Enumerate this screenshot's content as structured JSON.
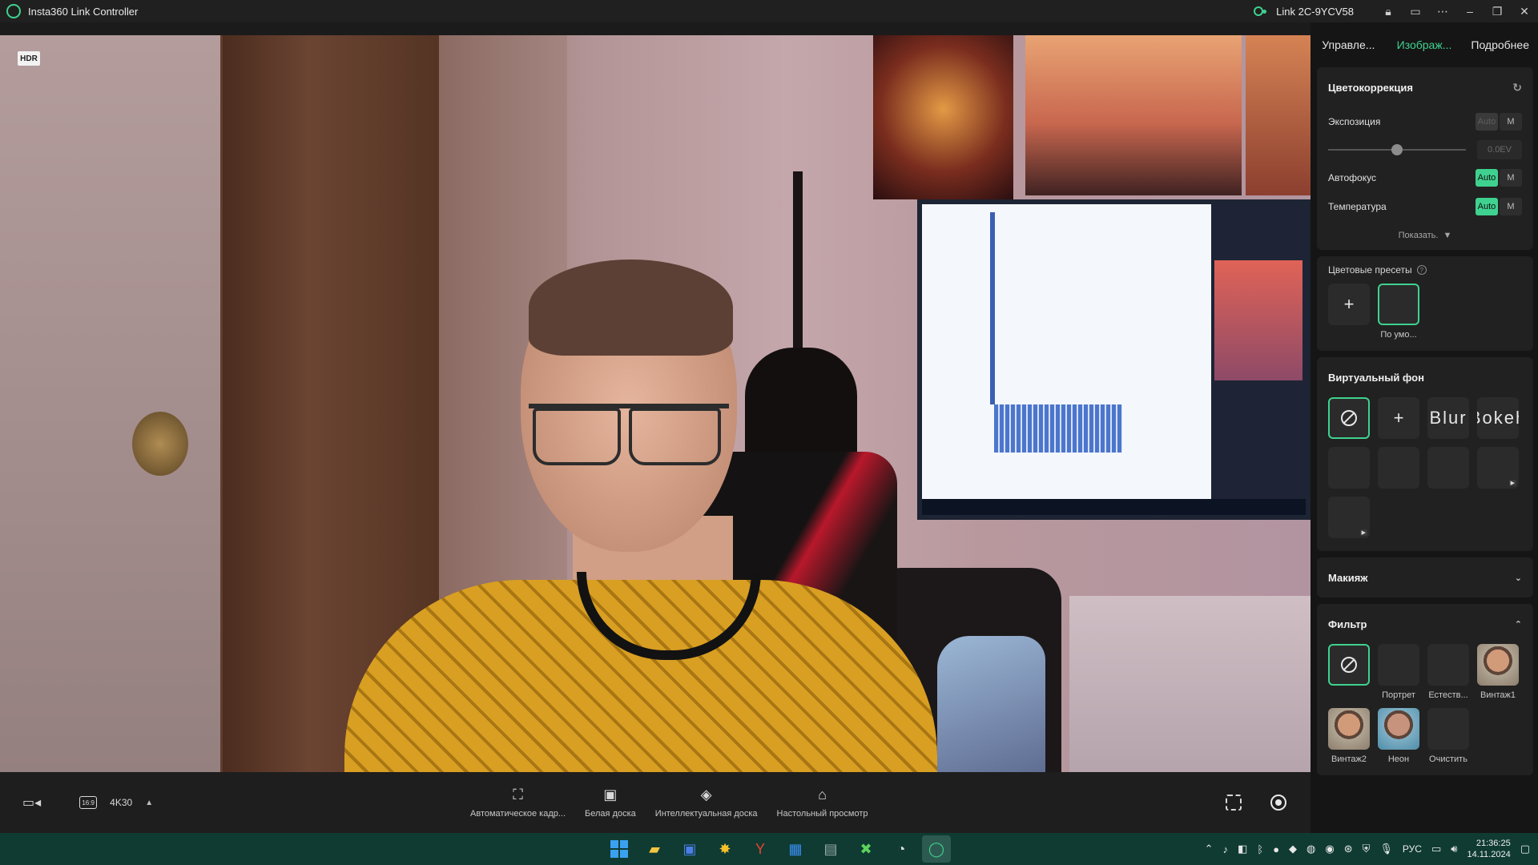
{
  "window": {
    "title": "Insta360 Link Controller",
    "device": "Link 2C-9YCV58"
  },
  "video": {
    "hdr_badge": "HDR"
  },
  "bottombar": {
    "ratio_label": "16:9",
    "resolution": "4K30",
    "tools": [
      {
        "label": "Автоматическое кадр..."
      },
      {
        "label": "Белая доска"
      },
      {
        "label": "Интеллектуальная доска"
      },
      {
        "label": "Настольный просмотр"
      }
    ]
  },
  "panel": {
    "tabs": [
      "Управле...",
      "Изображ...",
      "Подробнее"
    ],
    "active_tab": 1,
    "color_correction": {
      "title": "Цветокоррекция",
      "exposure_label": "Экспозиция",
      "exposure_value": "0.0EV",
      "exposure_slider": 0.5,
      "autofocus_label": "Автофокус",
      "temperature_label": "Температура",
      "auto": "Auto",
      "manual": "M",
      "show_more": "Показать."
    },
    "color_presets": {
      "title": "Цветовые пресеты",
      "default_caption": "По умо..."
    },
    "virtual_bg": {
      "title": "Виртуальный фон",
      "blur": "Blur",
      "bokeh": "Bokeh"
    },
    "makeup": {
      "title": "Макияж"
    },
    "filter": {
      "title": "Фильтр",
      "items": [
        "Портрет",
        "Естеств...",
        "Винтаж1",
        "Винтаж2",
        "Неон",
        "Очистить"
      ]
    }
  },
  "taskbar": {
    "lang": "РУС",
    "time": "21:36:25",
    "date": "14.11.2024"
  },
  "colors": {
    "accent": "#3fd18f",
    "panel_bg": "#151515",
    "card_bg": "#212121",
    "taskbar": "#0f3b32"
  }
}
